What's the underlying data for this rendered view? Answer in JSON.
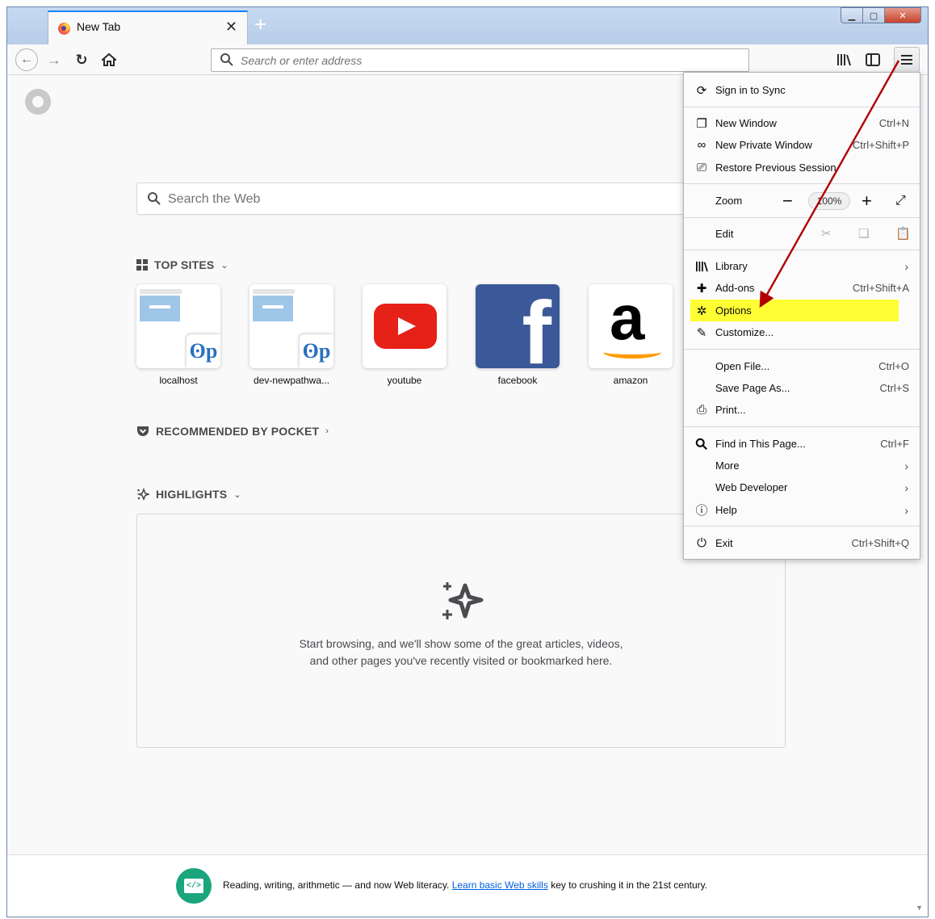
{
  "browser": {
    "tab_title": "New Tab",
    "url_placeholder": "Search or enter address"
  },
  "newtab": {
    "search_placeholder": "Search the Web",
    "top_sites_title": "TOP SITES",
    "top_sites": [
      {
        "label": "localhost",
        "icon": "vp-logo"
      },
      {
        "label": "dev-newpathwa...",
        "icon": "vp-logo"
      },
      {
        "label": "youtube",
        "icon": "youtube-logo"
      },
      {
        "label": "facebook",
        "icon": "facebook-logo"
      },
      {
        "label": "amazon",
        "icon": "amazon-logo"
      }
    ],
    "vp_glyph": "ʘp",
    "fb_glyph": "f",
    "amz_glyph": "a",
    "pocket_title": "RECOMMENDED BY POCKET",
    "highlights_title": "HIGHLIGHTS",
    "highlights_empty": "Start browsing, and we'll show some of the great articles, videos, and other pages you've recently visited or bookmarked here.",
    "snippet": {
      "before": "Reading, writing, arithmetic — and now Web literacy. ",
      "link": "Learn basic Web skills",
      "after": " key to crushing it in the 21st century."
    }
  },
  "menu": {
    "sign_in": "Sign in to Sync",
    "new_window": {
      "label": "New Window",
      "shortcut": "Ctrl+N"
    },
    "new_private": {
      "label": "New Private Window",
      "shortcut": "Ctrl+Shift+P"
    },
    "restore": {
      "label": "Restore Previous Session"
    },
    "zoom": {
      "label": "Zoom",
      "value": "100%"
    },
    "edit": {
      "label": "Edit"
    },
    "library": {
      "label": "Library"
    },
    "addons": {
      "label": "Add-ons",
      "shortcut": "Ctrl+Shift+A"
    },
    "options": {
      "label": "Options",
      "highlight": "#ffff33"
    },
    "customize": {
      "label": "Customize..."
    },
    "open_file": {
      "label": "Open File...",
      "shortcut": "Ctrl+O"
    },
    "save_page": {
      "label": "Save Page As...",
      "shortcut": "Ctrl+S"
    },
    "print": {
      "label": "Print..."
    },
    "find": {
      "label": "Find in This Page...",
      "shortcut": "Ctrl+F"
    },
    "more": {
      "label": "More"
    },
    "web_dev": {
      "label": "Web Developer"
    },
    "help": {
      "label": "Help"
    },
    "exit": {
      "label": "Exit",
      "shortcut": "Ctrl+Shift+Q"
    }
  },
  "annotation": {
    "arrow_color": "#b00000"
  }
}
